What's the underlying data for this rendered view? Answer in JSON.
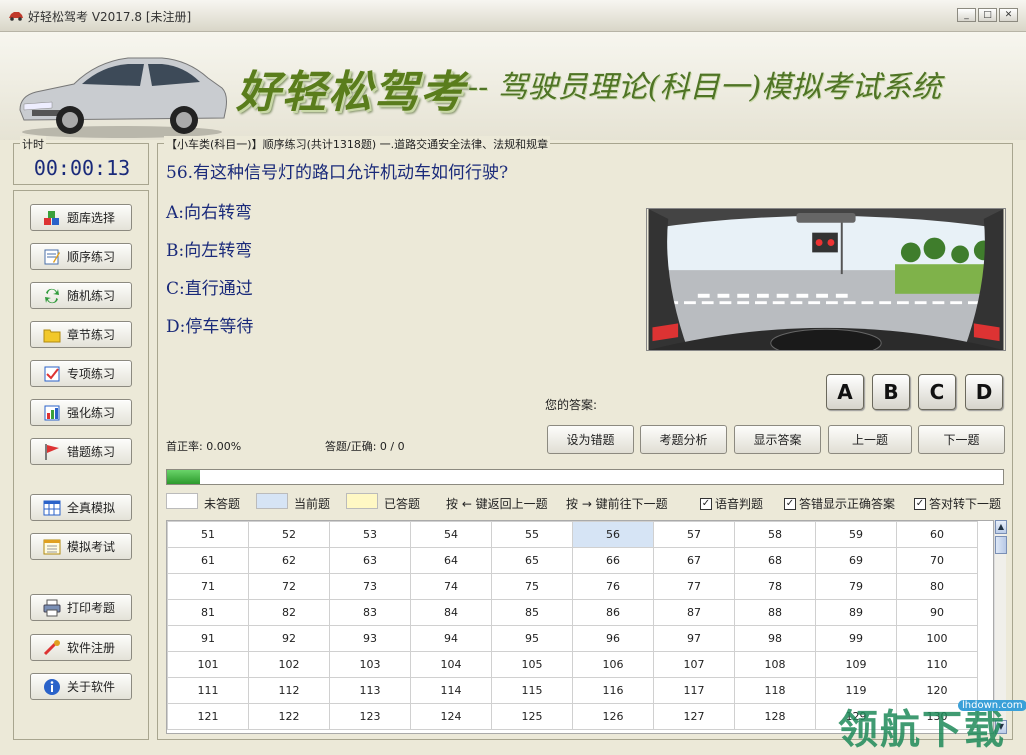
{
  "window": {
    "title": "好轻松驾考 V2017.8 [未注册]",
    "min": "_",
    "max": "□",
    "close": "✕"
  },
  "header": {
    "brand": "好轻松驾考",
    "subtitle": "-- 驾驶员理论(科目一)模拟考试系统"
  },
  "timer": {
    "label": "计时",
    "value": "00:00:13"
  },
  "sidebar": {
    "items": [
      {
        "label": "题库选择",
        "icon": "cubes-icon"
      },
      {
        "label": "顺序练习",
        "icon": "notepad-icon"
      },
      {
        "label": "随机练习",
        "icon": "shuffle-icon"
      },
      {
        "label": "章节练习",
        "icon": "folder-icon"
      },
      {
        "label": "专项练习",
        "icon": "checkbox-icon"
      },
      {
        "label": "强化练习",
        "icon": "chart-icon"
      },
      {
        "label": "错题练习",
        "icon": "flag-icon"
      },
      {
        "label": "全真模拟",
        "icon": "grid-icon"
      },
      {
        "label": "模拟考试",
        "icon": "calendar-icon"
      },
      {
        "label": "打印考题",
        "icon": "printer-icon"
      },
      {
        "label": "软件注册",
        "icon": "key-icon"
      },
      {
        "label": "关于软件",
        "icon": "info-icon"
      }
    ]
  },
  "main": {
    "breadcrumb": "【小车类(科目一)】顺序练习(共计1318题) 一.道路交通安全法律、法规和规章",
    "question": "56.有这种信号灯的路口允许机动车如何行驶?",
    "options": [
      "A:向右转弯",
      "B:向左转弯",
      "C:直行通过",
      "D:停车等待"
    ],
    "your_answer_label": "您的答案:",
    "answer_buttons": [
      "A",
      "B",
      "C",
      "D"
    ],
    "accuracy": "首正率: 0.00%",
    "answered": "答题/正确: 0 / 0",
    "actions": [
      "设为错题",
      "考题分析",
      "显示答案",
      "上一题",
      "下一题"
    ],
    "progress": 0.04,
    "legend": {
      "unanswered": "未答题",
      "current": "当前题",
      "answered": "已答题",
      "hint_left": "按 ← 键返回上一题",
      "hint_right": "按 → 键前往下一题",
      "chk_voice": "语音判题",
      "chk_show_correct": "答错显示正确答案",
      "chk_auto_next": "答对转下一题",
      "check_mark": "✓"
    },
    "grid_rows": [
      [
        "51",
        "52",
        "53",
        "54",
        "55",
        "56",
        "57",
        "58",
        "59",
        "60"
      ],
      [
        "61",
        "62",
        "63",
        "64",
        "65",
        "66",
        "67",
        "68",
        "69",
        "70"
      ],
      [
        "71",
        "72",
        "73",
        "74",
        "75",
        "76",
        "77",
        "78",
        "79",
        "80"
      ],
      [
        "81",
        "82",
        "83",
        "84",
        "85",
        "86",
        "87",
        "88",
        "89",
        "90"
      ],
      [
        "91",
        "92",
        "93",
        "94",
        "95",
        "96",
        "97",
        "98",
        "99",
        "100"
      ],
      [
        "101",
        "102",
        "103",
        "104",
        "105",
        "106",
        "107",
        "108",
        "109",
        "110"
      ],
      [
        "111",
        "112",
        "113",
        "114",
        "115",
        "116",
        "117",
        "118",
        "119",
        "120"
      ],
      [
        "121",
        "122",
        "123",
        "124",
        "125",
        "126",
        "127",
        "128",
        "129",
        "130"
      ]
    ],
    "current_question": "56",
    "scroll": {
      "up": "▲",
      "down": "▼"
    }
  },
  "watermark": {
    "text": "领航下载",
    "url": "lhdown.com"
  },
  "colors": {
    "accent_blue": "#1a2a7a",
    "brand_green": "#5a7d1c",
    "current_cell": "#d6e4f5",
    "answered_cell": "#fff8c4"
  }
}
